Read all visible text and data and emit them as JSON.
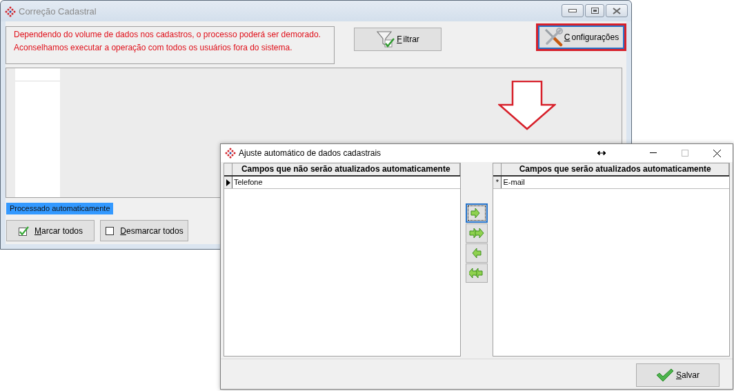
{
  "main_window": {
    "title": "Correção Cadastral",
    "active": false,
    "warning": [
      "Dependendo do volume de dados nos cadastros, o processo poderá ser demorado.",
      "Aconselhamos executar a operação com todos os usuários fora do sistema."
    ],
    "toolbar_buttons": [
      {
        "label": "Filtrar",
        "kind": "filter",
        "focused": false,
        "annotated": false
      },
      {
        "label": "Configurações",
        "kind": "tools",
        "focused": true,
        "annotated": true
      }
    ],
    "status_label": "Processado automaticamente",
    "selection_buttons": [
      {
        "label": "Marcar todos",
        "kind": "check-all"
      },
      {
        "label": "Desmarcar todos",
        "kind": "uncheck-all"
      }
    ]
  },
  "dialog": {
    "title": "Ajuste automático de dados cadastrais",
    "active": true,
    "left_grid": {
      "header": "Campos que não serão atualizados automaticamente",
      "rows": [
        {
          "marker": "",
          "value": "Telefone",
          "current": true
        }
      ]
    },
    "right_grid": {
      "header": "Campos que serão atualizados automaticamente",
      "rows": [
        {
          "marker": "*",
          "value": "E-mail",
          "current": false
        }
      ]
    },
    "move_buttons": [
      {
        "kind": "right",
        "focused": true
      },
      {
        "kind": "all-right",
        "focused": false
      },
      {
        "kind": "left",
        "focused": false
      },
      {
        "kind": "all-left",
        "focused": false
      }
    ],
    "save_button": {
      "label": "Salvar"
    }
  }
}
